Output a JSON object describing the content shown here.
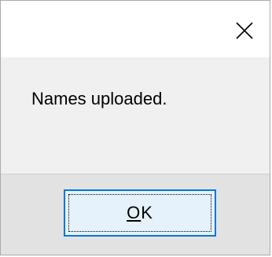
{
  "dialog": {
    "message": "Names uploaded.",
    "close_icon": "close-icon",
    "ok_button": {
      "mnemonic": "O",
      "rest": "K"
    }
  },
  "colors": {
    "title_bar_bg": "#ffffff",
    "content_bg": "#f0f0f0",
    "button_area_bg": "#e2e2e2",
    "ok_border": "#0078d7",
    "ok_bg": "#e5f1fb"
  }
}
